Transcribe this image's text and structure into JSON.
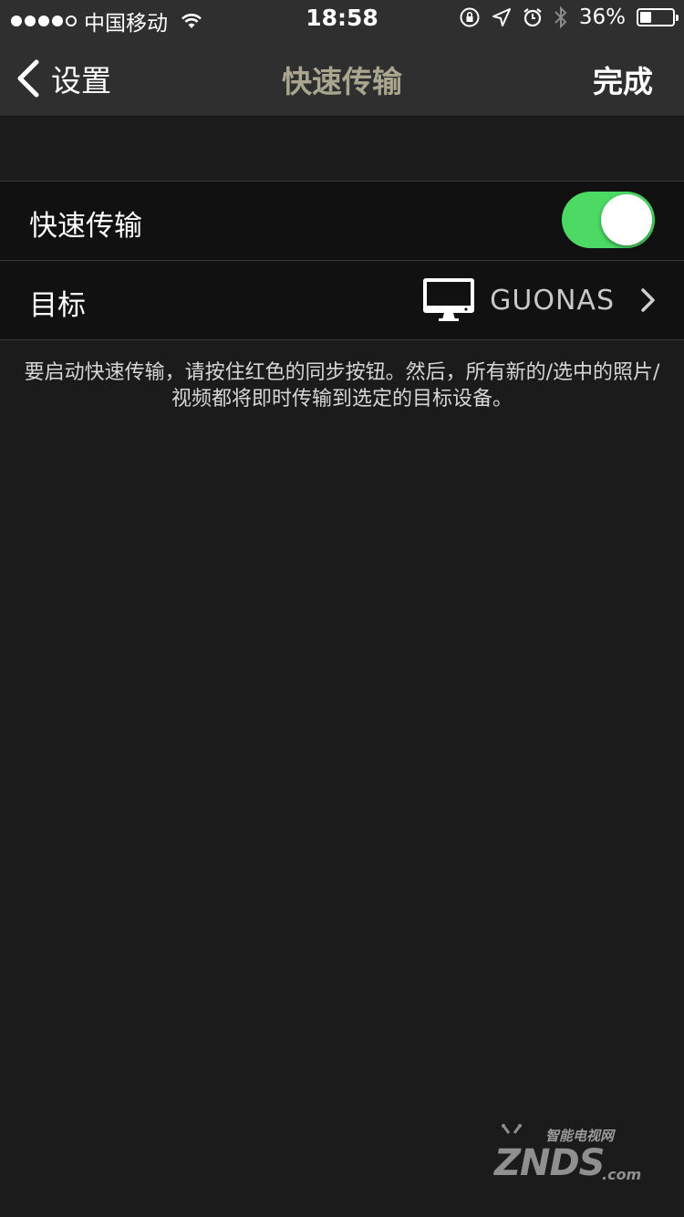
{
  "status_bar": {
    "carrier": "中国移动",
    "time": "18:58",
    "battery_percent": "36%",
    "battery_level": 0.36,
    "icons": [
      "signal-dots-icon",
      "wifi-icon",
      "rotation-lock-icon",
      "location-icon",
      "alarm-icon",
      "bluetooth-icon",
      "battery-icon"
    ]
  },
  "nav": {
    "back_label": "设置",
    "title": "快速传输",
    "done_label": "完成"
  },
  "settings": {
    "quick_transfer": {
      "label": "快速传输",
      "enabled": true
    },
    "target": {
      "label": "目标",
      "value": "GUONAS",
      "icon": "monitor-icon"
    }
  },
  "description": "要启动快速传输，请按住红色的同步按钮。然后，所有新的/选中的照片/视频都将即时传输到选定的目标设备。",
  "watermark": {
    "cn": "智能电视网",
    "en": "ZNDS",
    "suffix": ".com"
  },
  "colors": {
    "background": "#1b1b1b",
    "bar": "#2f2f2f",
    "row": "#111111",
    "toggle_on": "#4cd964",
    "title": "#a9a58e"
  }
}
